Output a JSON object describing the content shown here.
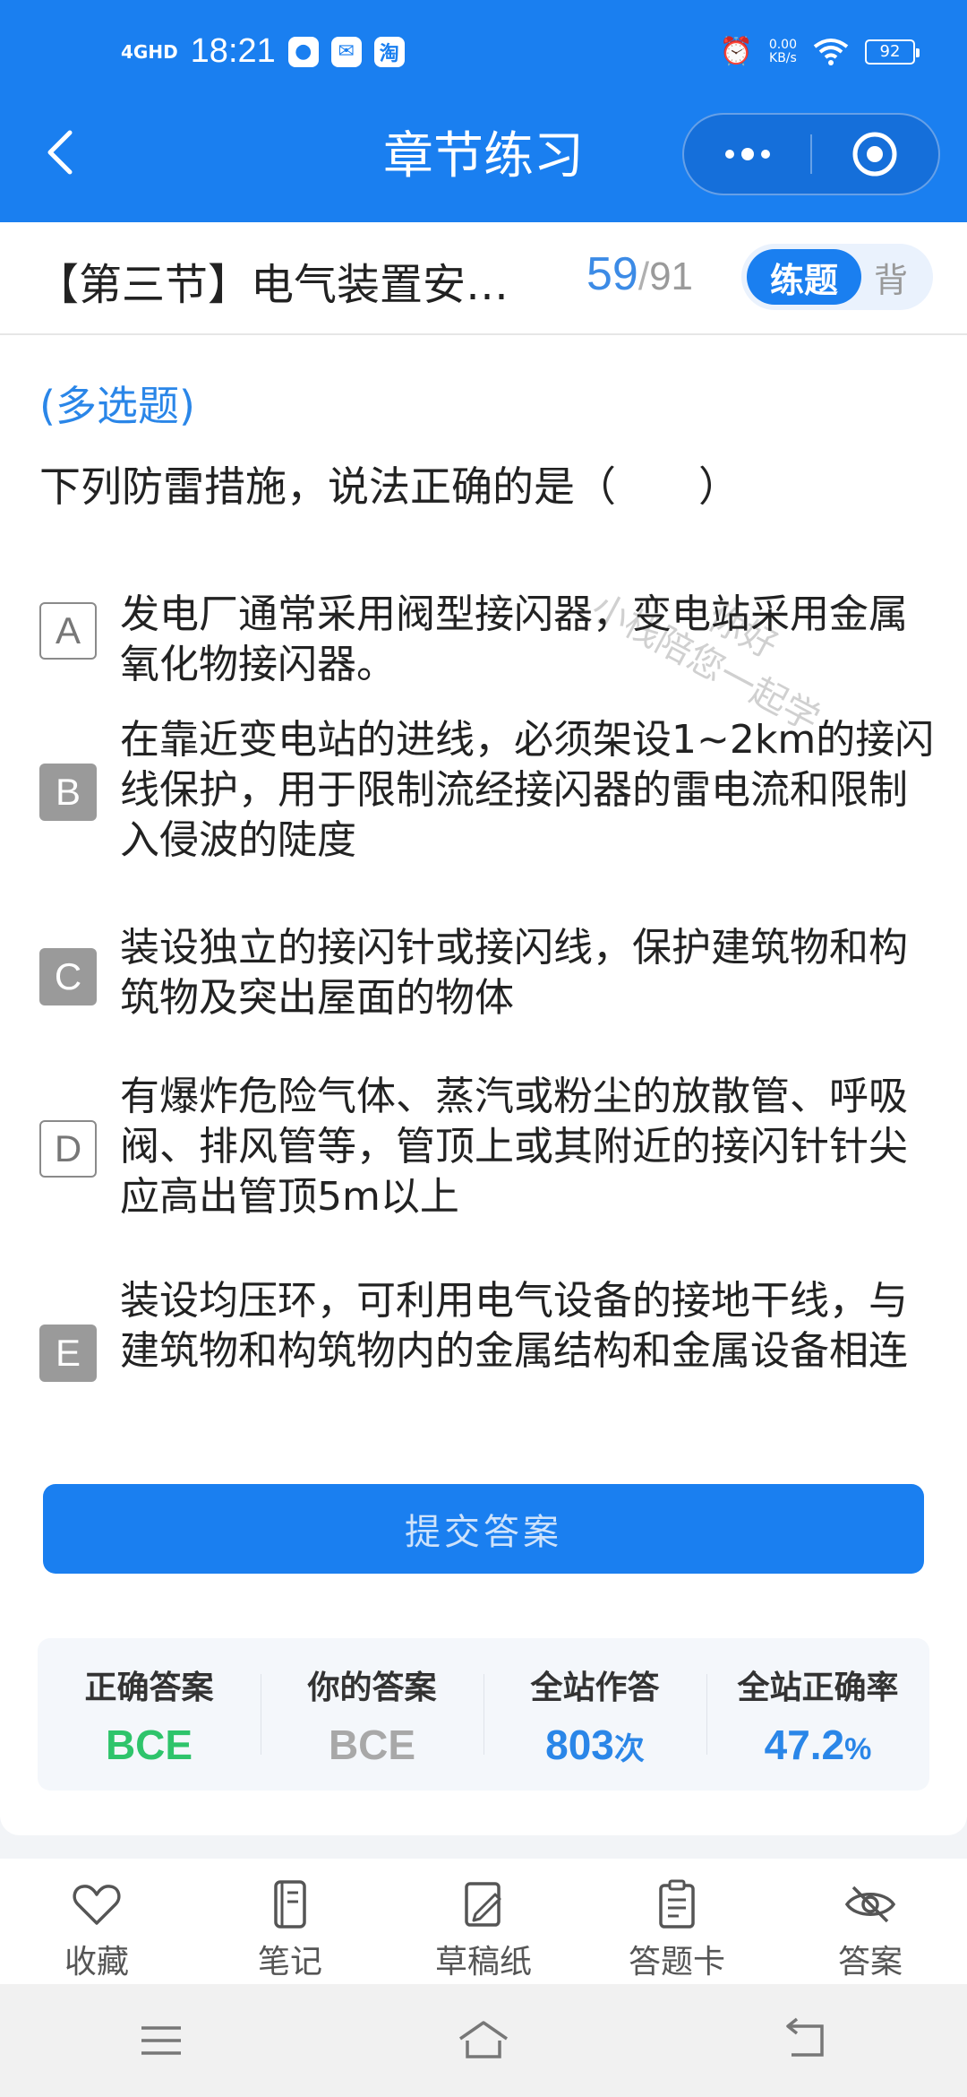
{
  "status_bar": {
    "network": "4GHD",
    "time": "18:21",
    "speed": "0.00",
    "speed_unit": "KB/s",
    "battery": "92",
    "app_icon_taobao": "淘"
  },
  "header": {
    "title": "章节练习",
    "back_icon": "chevron-left-icon",
    "more_icon": "more-dots-icon",
    "close_icon": "target-circle-icon"
  },
  "chapter": {
    "title": "【第三节】电气装置安…",
    "current": "59",
    "separator": "/",
    "total": "91",
    "mode_active": "练题",
    "mode_inactive": "背"
  },
  "question": {
    "type": "(多选题)",
    "text": "下列防雷措施，说法正确的是（　　）"
  },
  "watermark": {
    "line1": "你好",
    "line2": "小栈陪您一起学"
  },
  "options": [
    {
      "letter": "A",
      "text": "发电厂通常采用阀型接闪器，变电站采用金属氧化物接闪器。"
    },
    {
      "letter": "B",
      "text": "在靠近变电站的进线，必须架设1~2km的接闪线保护，用于限制流经接闪器的雷电流和限制入侵波的陡度"
    },
    {
      "letter": "C",
      "text": "装设独立的接闪针或接闪线，保护建筑物和构筑物及突出屋面的物体"
    },
    {
      "letter": "D",
      "text": "有爆炸危险气体、蒸汽或粉尘的放散管、呼吸阀、排风管等，管顶上或其附近的接闪针针尖应高出管顶5m以上"
    },
    {
      "letter": "E",
      "text": "装设均压环，可利用电气设备的接地干线，与建筑物和构筑物内的金属结构和金属设备相连"
    }
  ],
  "submit_button": "提交答案",
  "stats": {
    "correct_label": "正确答案",
    "correct_value": "BCE",
    "yours_label": "你的答案",
    "yours_value": "BCE",
    "attempts_label": "全站作答",
    "attempts_value": "803",
    "attempts_unit": "次",
    "rate_label": "全站正确率",
    "rate_value": "47.2",
    "rate_unit": "%"
  },
  "toolbar": {
    "favorite": "收藏",
    "notes": "笔记",
    "scratch": "草稿纸",
    "answer_card": "答题卡",
    "answer": "答案"
  },
  "colors": {
    "primary": "#1a7ff0",
    "correct": "#2ec46b",
    "accent_blue": "#2a86e8"
  }
}
